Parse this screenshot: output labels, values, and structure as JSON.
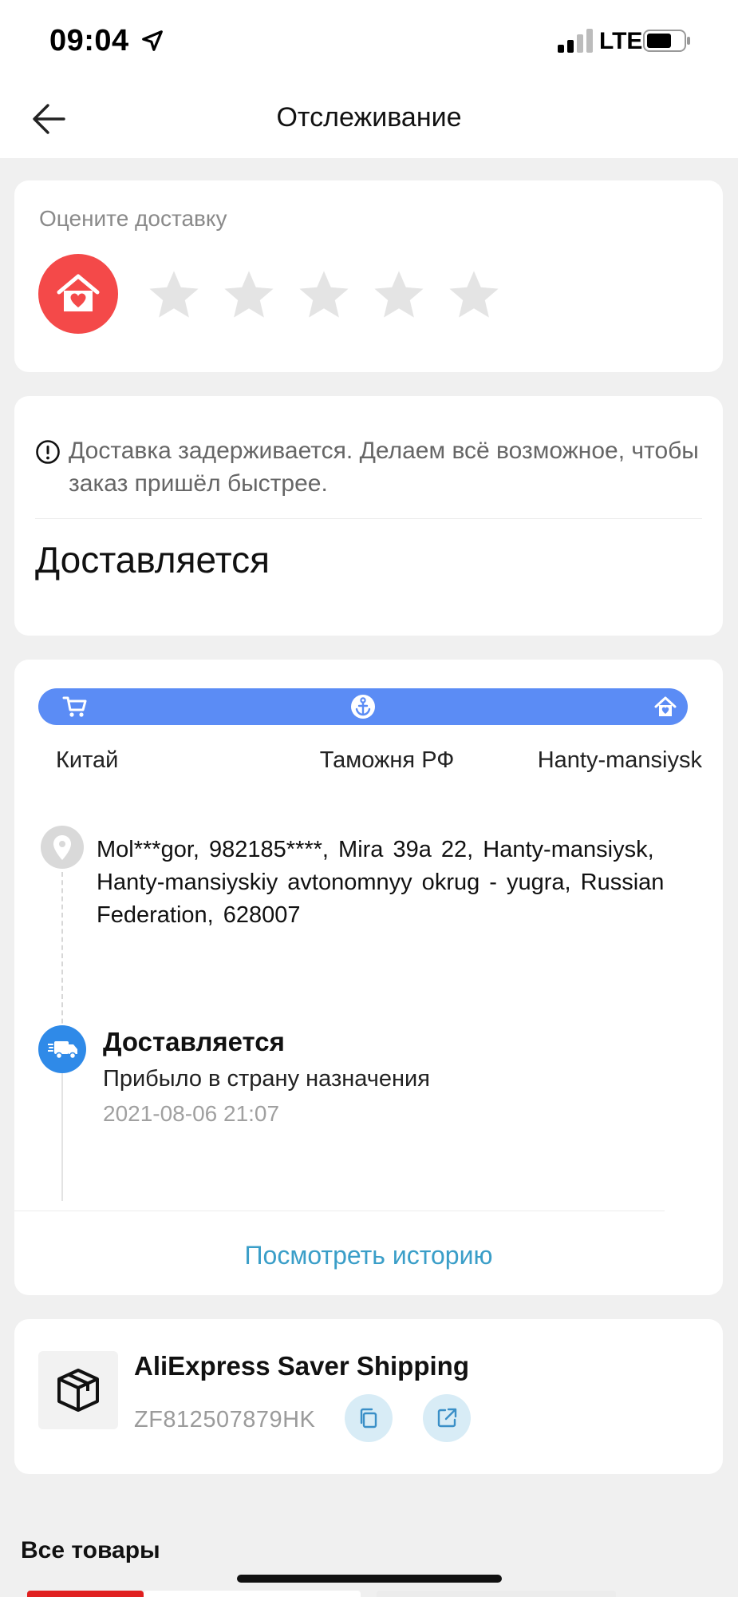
{
  "status_bar": {
    "time": "09:04",
    "network": "LTE"
  },
  "header": {
    "title": "Отслеживание"
  },
  "rating": {
    "label": "Оцените доставку",
    "stars_total": 5,
    "stars_filled": 0,
    "star_color": "#e4e4e4",
    "icon_color": "#f44949"
  },
  "status": {
    "notice": "Доставка задерживается. Делаем всё возможное, чтобы заказ пришёл быстрее.",
    "title": "Доставляется"
  },
  "route": {
    "bar_color": "#5b8cf5",
    "stops": [
      {
        "label": "Китай",
        "icon": "cart-icon"
      },
      {
        "label": "Таможня РФ",
        "icon": "anchor-icon"
      },
      {
        "label": "Hanty-mansiysk",
        "icon": "home-icon"
      }
    ]
  },
  "delivery_address": "Mol***gor, 982185****, Mira 39a 22, Hanty-mansiysk, Hanty-mansiyskiy avtonomnyy okrug - yugra, Russian Federation, 628007",
  "event": {
    "title": "Доставляется",
    "description": "Прибыло в страну назначения",
    "time": "2021-08-06 21:07"
  },
  "history_link": "Посмотреть историю",
  "shipping": {
    "method": "AliExpress Saver Shipping",
    "tracking_number": "ZF812507879HK"
  },
  "all_goods_title": "Все товары"
}
